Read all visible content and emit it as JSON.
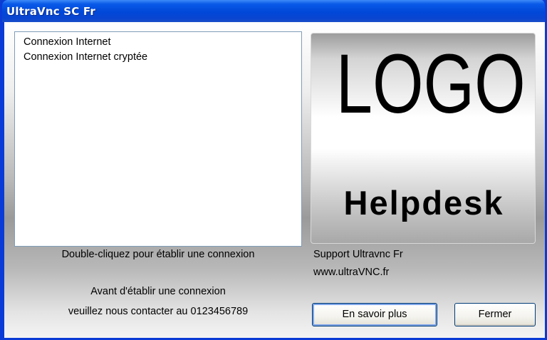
{
  "window": {
    "title": "UltraVnc SC Fr"
  },
  "connections": {
    "items": [
      {
        "label": "Connexion Internet"
      },
      {
        "label": "Connexion Internet cryptée"
      }
    ],
    "hint": "Double-cliquez pour établir une connexion"
  },
  "notice": {
    "line1": "Avant d'établir une connexion",
    "line2": "veuillez nous contacter au 0123456789"
  },
  "logo": {
    "main_text": "LOGO",
    "sub_text": "Helpdesk"
  },
  "support": {
    "name": "Support Ultravnc Fr",
    "website": "www.ultraVNC.fr"
  },
  "buttons": {
    "more_info": "En savoir plus",
    "close": "Fermer"
  }
}
